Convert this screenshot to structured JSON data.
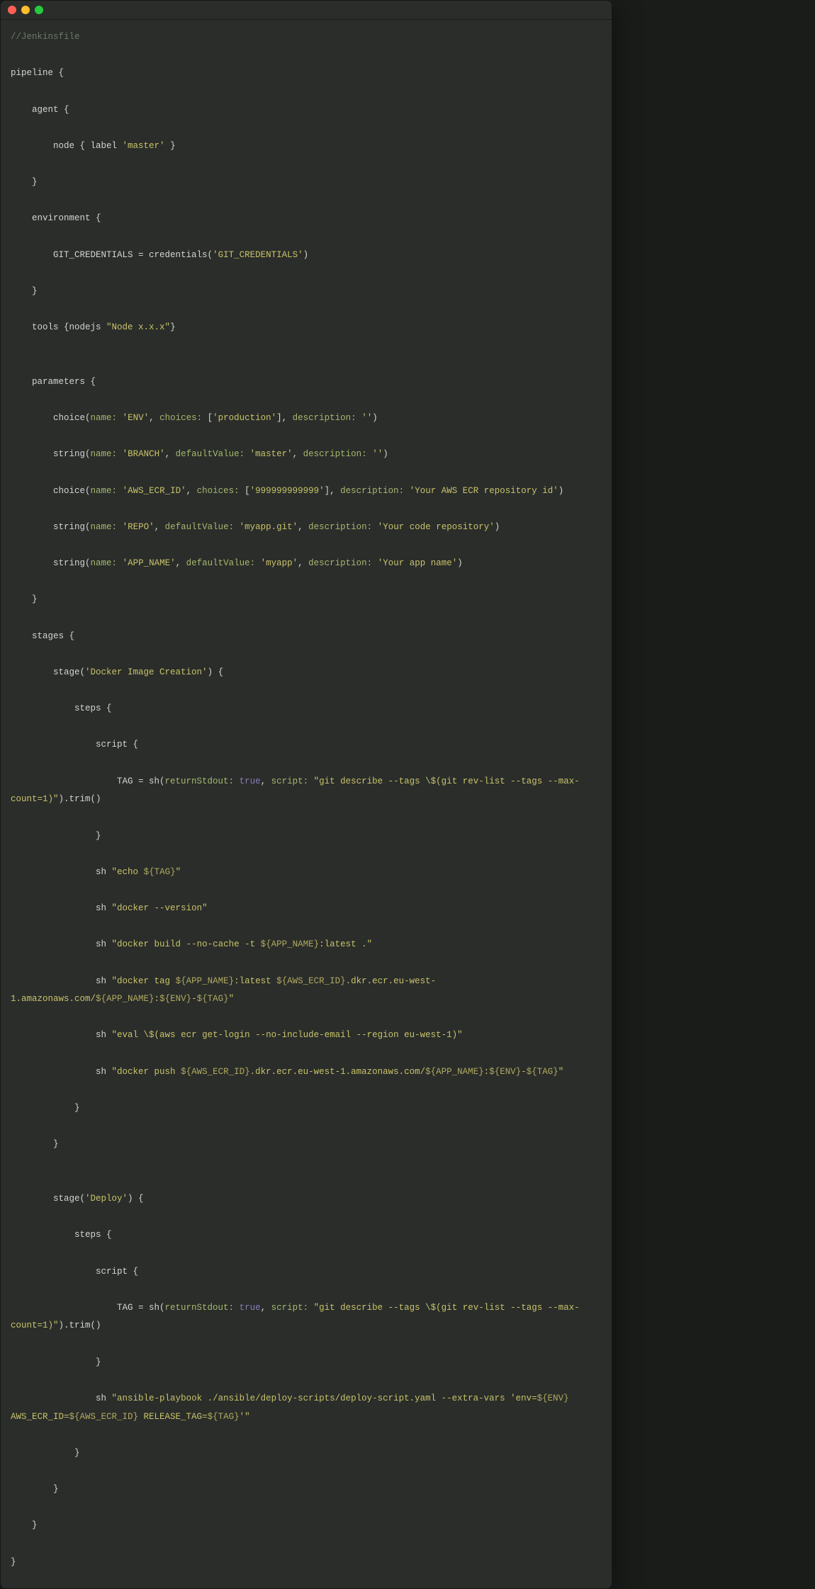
{
  "comment": "//Jenkinsfile",
  "code": {
    "pipeline": "pipeline {",
    "agent": "    agent {",
    "node_open": "        node { label ",
    "node_label": "'master'",
    "node_close": " }",
    "brace_close1": "    }",
    "env_open": "    environment {",
    "git_cred_a": "        GIT_CREDENTIALS = credentials(",
    "git_cred_v": "'GIT_CREDENTIALS'",
    "git_cred_b": ")",
    "tools_a": "    tools {nodejs ",
    "tools_v": "\"Node x.x.x\"",
    "tools_b": "}",
    "params_open": "    parameters {",
    "p1_a": "        choice(",
    "p1_name_k": "name:",
    "p1_name_v": "'ENV'",
    "p1_sep1": ", ",
    "p1_ch_k": "choices:",
    "p1_ch_o": " [",
    "p1_ch_v": "'production'",
    "p1_ch_c": "], ",
    "p1_desc_k": "description:",
    "p1_desc_v": "''",
    "paren_close": ")",
    "p2_a": "        string(",
    "p2_name_v": "'BRANCH'",
    "p2_dv_k": "defaultValue:",
    "p2_dv_v": "'master'",
    "p3_a": "        choice(",
    "p3_name_v": "'AWS_ECR_ID'",
    "p3_ch_v": "'999999999999'",
    "p3_desc_v": "'Your AWS ECR repository id'",
    "p4_name_v": "'REPO'",
    "p4_dv_v": "'myapp.git'",
    "p4_desc_v": "'Your code repository'",
    "p5_name_v": "'APP_NAME'",
    "p5_dv_v": "'myapp'",
    "p5_desc_v": "'Your app name'",
    "stages_open": "    stages {",
    "stage1_a": "        stage(",
    "stage1_v": "'Docker Image Creation'",
    "stage1_b": ") {",
    "steps_open": "            steps {",
    "script_open": "                script {",
    "tag_a": "                    TAG = sh(",
    "tag_rs_k": "returnStdout:",
    "tag_rs_v": "true",
    "tag_sep": ", ",
    "tag_sc_k": "script:",
    "tag_sc_o": " ",
    "tag_sc_v": "\"git describe --tags \\$(git rev-list --tags --max-count=1)\"",
    "tag_b": ").trim()",
    "script_close": "                }",
    "sh1_a": "                sh ",
    "sh1_v_a": "\"echo ",
    "sh1_v_b": "${TAG}",
    "sh1_v_c": "\"",
    "sh2_v": "\"docker --version\"",
    "sh3_v_a": "\"docker build --no-cache -t ",
    "sh3_v_b": "${APP_NAME}",
    "sh3_v_c": ":latest .\"",
    "sh4_v_a": "\"docker tag ",
    "sh4_v_b": ":latest ",
    "sh4_v_c": "${AWS_ECR_ID}",
    "sh4_v_d": ".dkr.ecr.eu-west-1.amazonaws.com/",
    "sh4_v_e": ":",
    "sh4_v_f": "${ENV}",
    "sh4_v_g": "-",
    "sh4_v_h": "\"",
    "sh5_v": "\"eval \\$(aws ecr get-login --no-include-email --region eu-west-1)\"",
    "sh6_v_a": "\"docker push ",
    "steps_close": "            }",
    "stage_close": "        }",
    "stage2_v": "'Deploy'",
    "sh7_v_a": "\"ansible-playbook ./ansible/deploy-scripts/deploy-script.yaml --extra-vars 'env=",
    "sh7_v_b": " AWS_ECR_ID=",
    "sh7_v_c": " RELEASE_TAG=",
    "sh7_v_d": "'\"",
    "pipeline_close": "}"
  }
}
